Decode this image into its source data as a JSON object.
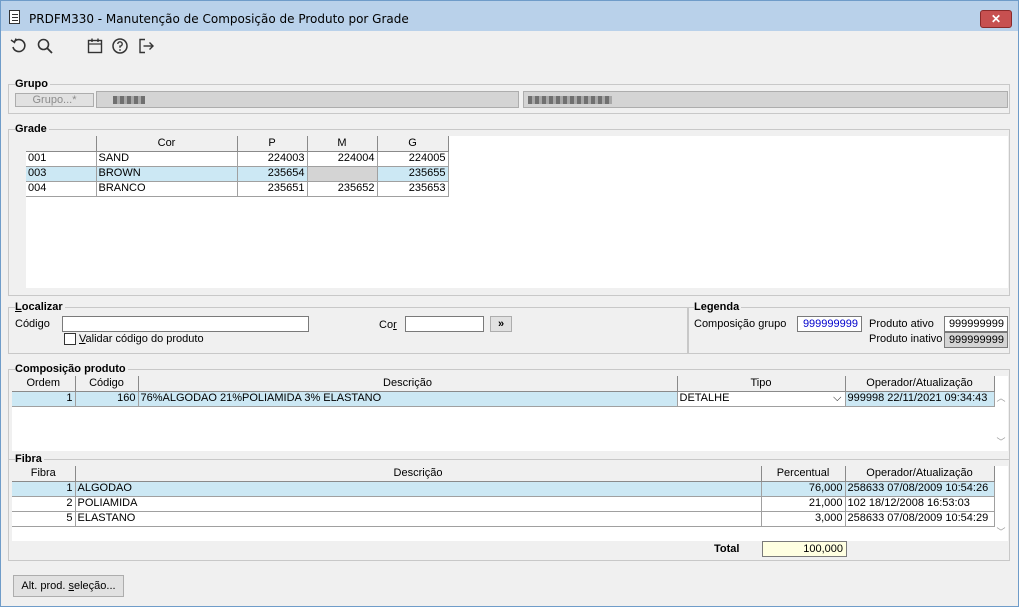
{
  "window": {
    "title": "PRDFM330 - Manutenção de Composição de Produto por Grade",
    "close_glyph": "✕"
  },
  "toolbar": {
    "icons": [
      "refresh-icon",
      "search-icon",
      "calendar-icon",
      "help-icon",
      "exit-icon"
    ]
  },
  "grupo": {
    "title": "Grupo",
    "button_label": "Grupo...*"
  },
  "grade": {
    "title": "Grade",
    "headers": [
      "",
      "Cor",
      "P",
      "M",
      "G"
    ],
    "rows": [
      [
        "001",
        "SAND",
        "224003",
        "224004",
        "224005"
      ],
      [
        "003",
        "BROWN",
        "235654",
        "",
        "235655"
      ],
      [
        "004",
        "BRANCO",
        "235651",
        "235652",
        "235653"
      ]
    ],
    "selected_row": 1
  },
  "localizar": {
    "title": "Localizar",
    "codigo_label": "Código",
    "codigo_value": "",
    "validar_label": "Validar código do produto",
    "validar_checked": false,
    "cor_label": "Cor",
    "cor_value": "",
    "go_label": "»"
  },
  "legenda": {
    "title": "Legenda",
    "comp_grupo_label": "Composição grupo",
    "comp_grupo_value": "999999999",
    "ativo_label": "Produto ativo",
    "ativo_value": "999999999",
    "inativo_label": "Produto inativo",
    "inativo_value": "999999999"
  },
  "composicao": {
    "title": "Composição produto",
    "headers": [
      "Ordem",
      "Código",
      "Descrição",
      "Tipo",
      "Operador/Atualização"
    ],
    "rows": [
      [
        "1",
        "160",
        "76%ALGODAO 21%POLIAMIDA 3% ELASTANO",
        "DETALHE",
        "999998 22/11/2021 09:34:43"
      ]
    ]
  },
  "fibra": {
    "title": "Fibra",
    "headers": [
      "Fibra",
      "Descrição",
      "Percentual",
      "Operador/Atualização"
    ],
    "rows": [
      [
        "1",
        "ALGODAO",
        "76,000",
        "258633 07/08/2009 10:54:26"
      ],
      [
        "2",
        "POLIAMIDA",
        "21,000",
        "102 18/12/2008 16:53:03"
      ],
      [
        "5",
        "ELASTANO",
        "3,000",
        "258633 07/08/2009 10:54:29"
      ]
    ],
    "selected_row": 0,
    "total_label": "Total",
    "total_value": "100,000"
  },
  "footer": {
    "alt_button_label": "Alt. prod. seleção..."
  },
  "colors": {
    "selected_row": "#cce8f4",
    "title_bar": "#b9d1ea",
    "close_button": "#c75050",
    "legend_comp_grupo_text": "#0000cc"
  }
}
